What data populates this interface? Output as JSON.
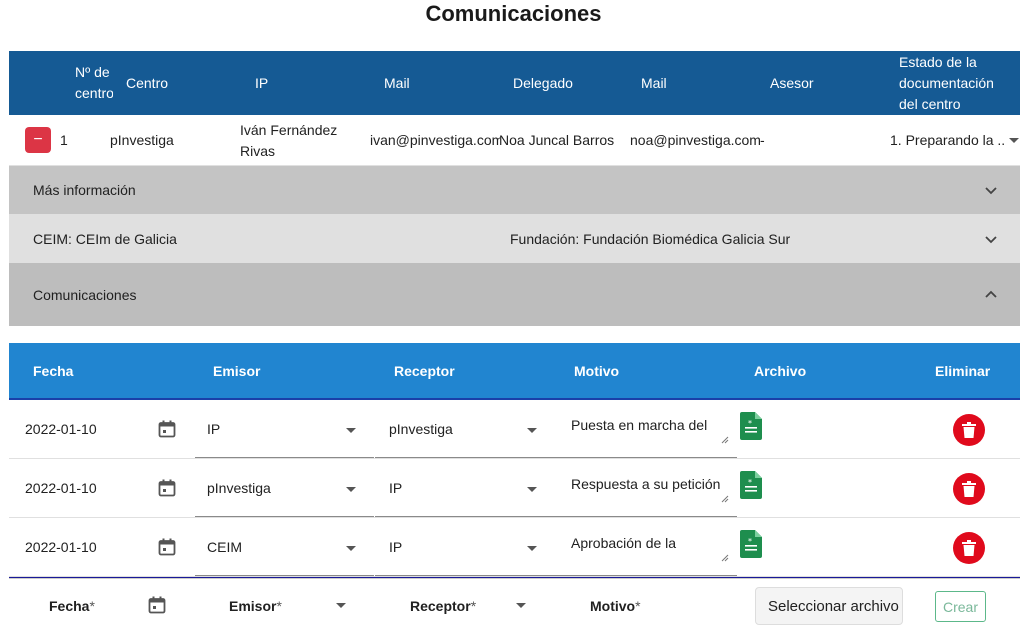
{
  "page": {
    "title": "Comunicaciones"
  },
  "main_table": {
    "headers": {
      "nro": "Nº de centro",
      "centro": "Centro",
      "ip": "IP",
      "mail1": "Mail",
      "delegado": "Delegado",
      "mail2": "Mail",
      "asesor": "Asesor",
      "estado": "Estado de la documentación del centro"
    },
    "row": {
      "nro": "1",
      "centro": "pInvestiga",
      "ip": "Iván Fernández Rivas",
      "mail1": "ivan@pinvestiga.com",
      "delegado": "Noa Juncal Barros",
      "mail2": "noa@pinvestiga.com",
      "asesor": "-",
      "estado": "1. Preparando la ..."
    },
    "collapse_label": "−"
  },
  "accordions": {
    "mas_info": "Más información",
    "ceim": "CEIM: CEIm de Galicia",
    "fundacion": "Fundación: Fundación Biomédica Galicia Sur",
    "comunicaciones": "Comunicaciones"
  },
  "comms_table": {
    "headers": {
      "fecha": "Fecha",
      "emisor": "Emisor",
      "receptor": "Receptor",
      "motivo": "Motivo",
      "archivo": "Archivo",
      "eliminar": "Eliminar"
    },
    "rows": [
      {
        "fecha": "2022-01-10",
        "emisor": "IP",
        "receptor": "pInvestiga",
        "motivo": "Puesta en marcha del"
      },
      {
        "fecha": "2022-01-10",
        "emisor": "pInvestiga",
        "receptor": "IP",
        "motivo": "Respuesta a su petición"
      },
      {
        "fecha": "2022-01-10",
        "emisor": "CEIM",
        "receptor": "IP",
        "motivo": "Aprobación de la"
      }
    ]
  },
  "new_entry": {
    "fecha_label": "Fecha",
    "emisor_label": "Emisor",
    "receptor_label": "Receptor",
    "motivo_label": "Motivo",
    "required_mark": "*",
    "file_button": "Seleccionar archivo",
    "create_button": "Crear"
  },
  "colors": {
    "header_dark_blue": "#155a94",
    "header_light_blue": "#2185d0",
    "delete_red": "#e00a1c",
    "file_green": "#1e8e4e",
    "collapse_red": "#dc3545"
  }
}
